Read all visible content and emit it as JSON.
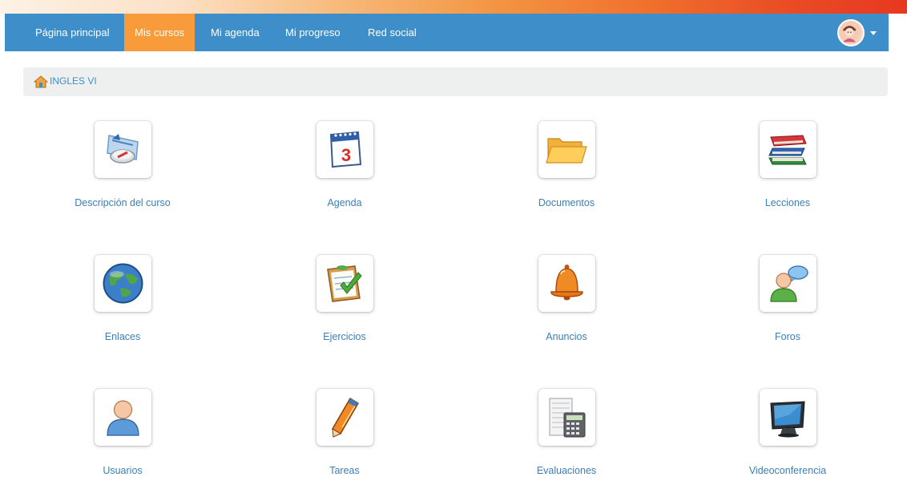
{
  "nav": {
    "items": [
      {
        "label": "Página principal"
      },
      {
        "label": "Mis cursos"
      },
      {
        "label": "Mi agenda"
      },
      {
        "label": "Mi progreso"
      },
      {
        "label": "Red social"
      }
    ],
    "active": "Mis cursos"
  },
  "breadcrumb": {
    "label": "INGLES VI"
  },
  "tools": [
    {
      "label": "Descripción del curso",
      "icon": "course-description-icon"
    },
    {
      "label": "Agenda",
      "icon": "calendar-icon"
    },
    {
      "label": "Documentos",
      "icon": "folder-icon"
    },
    {
      "label": "Lecciones",
      "icon": "books-icon"
    },
    {
      "label": "Enlaces",
      "icon": "globe-icon"
    },
    {
      "label": "Ejercicios",
      "icon": "checklist-icon"
    },
    {
      "label": "Anuncios",
      "icon": "bell-icon"
    },
    {
      "label": "Foros",
      "icon": "forum-icon"
    },
    {
      "label": "Usuarios",
      "icon": "user-icon"
    },
    {
      "label": "Tareas",
      "icon": "pencil-icon"
    },
    {
      "label": "Evaluaciones",
      "icon": "calculator-icon"
    },
    {
      "label": "Videoconferencia",
      "icon": "monitor-icon"
    }
  ],
  "colors": {
    "navbar": "#3d8ec9",
    "active_tab": "#f79b3b",
    "link": "#3b7fb6",
    "breadcrumb_bg": "#eef0ef"
  },
  "calendar_day": "3"
}
